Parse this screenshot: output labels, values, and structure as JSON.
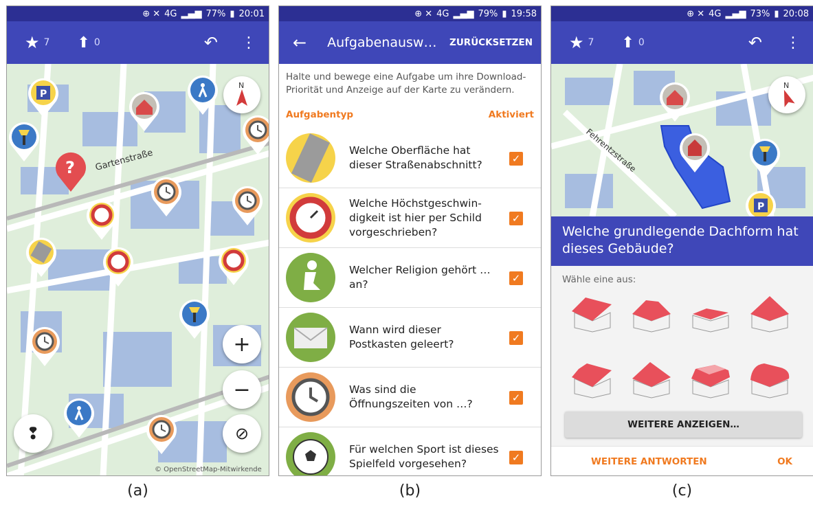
{
  "panel_a": {
    "status": {
      "battery": "77%",
      "time": "20:01",
      "net": "4G"
    },
    "toolbar": {
      "stars": "7",
      "uploads": "0"
    },
    "map": {
      "street_label": "Gartenstraße",
      "compass_label": "N",
      "attribution": "© OpenStreetMap-Mitwirkende"
    },
    "caption": "(a)"
  },
  "panel_b": {
    "status": {
      "battery": "79%",
      "time": "19:58",
      "net": "4G"
    },
    "toolbar": {
      "title": "Aufgabenausw…",
      "reset": "ZURÜCKSETZEN"
    },
    "intro": "Halte und bewege eine Aufgabe um ihre Download-Priorität und Anzeige auf der Karte zu verändern.",
    "header": {
      "type": "Aufgabentyp",
      "enabled": "Aktiviert"
    },
    "items": [
      {
        "icon": "surface-icon",
        "text": "Welche Oberfläche hat dieser Straßenabschnitt?"
      },
      {
        "icon": "speed-limit-icon",
        "text": "Welche Höchstgeschwin-digkeit ist hier per Schild vorgeschrieben?"
      },
      {
        "icon": "religion-icon",
        "text": "Welcher Religion gehört … an?"
      },
      {
        "icon": "mail-icon",
        "text": "Wann wird dieser Postkasten geleert?"
      },
      {
        "icon": "clock-icon",
        "text": "Was sind die Öffnungszeiten von …?"
      },
      {
        "icon": "soccer-icon",
        "text": "Für welchen Sport ist dieses Spielfeld vorgesehen?"
      }
    ],
    "caption": "(b)"
  },
  "panel_c": {
    "status": {
      "battery": "73%",
      "time": "20:08",
      "net": "4G"
    },
    "toolbar": {
      "stars": "7",
      "uploads": "0"
    },
    "map": {
      "street_label": "Fehrentzstraße",
      "compass_label": "N"
    },
    "question": "Welche grundlegende Dachform hat dieses Gebäude?",
    "choose": "Wähle eine aus:",
    "more_button": "WEITERE ANZEIGEN…",
    "other_answers": "WEITERE ANTWORTEN",
    "ok": "OK",
    "caption": "(c)"
  },
  "colors": {
    "appbar": "#3f47b8",
    "statusbar": "#2c2f93",
    "accent": "#f07a20",
    "roof": "#e8505b",
    "map_bg": "#dfeedb"
  }
}
